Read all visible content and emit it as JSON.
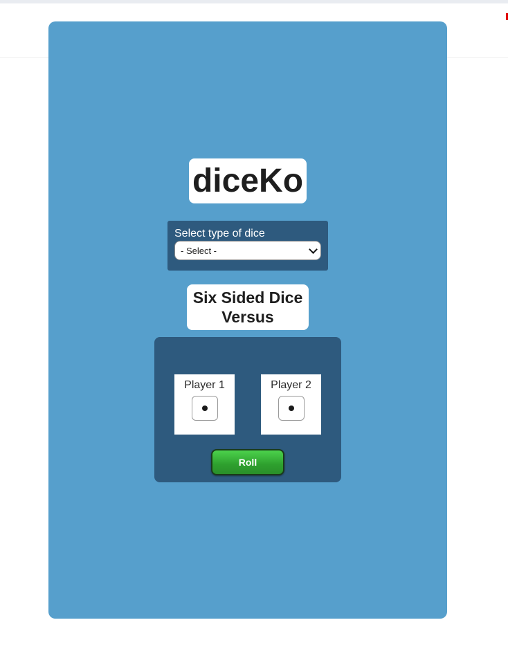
{
  "app": {
    "title": "diceKo"
  },
  "dice_select": {
    "label": "Select type of dice",
    "selected_value": "- Select -"
  },
  "mode": {
    "line1": "Six Sided Dice",
    "line2": "Versus"
  },
  "players": [
    {
      "name": "Player 1",
      "die_face": 1
    },
    {
      "name": "Player 2",
      "die_face": 1
    }
  ],
  "actions": {
    "roll_label": "Roll"
  },
  "colors": {
    "panel": "#569fcc",
    "dark_panel": "#2e5a7e",
    "roll_button": "#3bb83b"
  }
}
